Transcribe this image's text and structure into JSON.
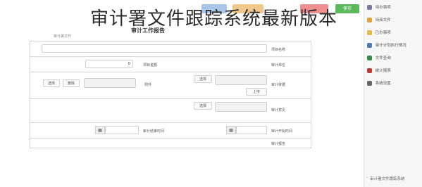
{
  "overlay": {
    "title": "审计署文件跟踪系统最新版本"
  },
  "colors": {
    "blue": "#a9c6e8",
    "orange": "#f2c98d",
    "red": "#ef8f8f",
    "green": "#5cb85c"
  },
  "toolbar": {
    "green_label": "保存"
  },
  "form": {
    "title": "审计工作报告",
    "subtitle": "审计署文件",
    "rows": [
      {
        "label": "项目名称"
      },
      {
        "label": "审计单位",
        "label_right": "项目金额",
        "amount_value": "0"
      },
      {
        "label": "审计依据",
        "btn_select": "选择",
        "btn_upload": "上传",
        "label_right": "附件",
        "btn_select2": "选择",
        "btn_delete": "删除"
      },
      {
        "label": "审计意见",
        "btn_select": "选择"
      },
      {
        "label": "审计开始时间",
        "label_right": "审计结束时间"
      },
      {
        "label": "审计报告"
      }
    ]
  },
  "sidebar": {
    "items": [
      {
        "label": "待办事项",
        "icon": "check-icon",
        "color": "#7a7aa0"
      },
      {
        "label": "待阅文件",
        "icon": "bell-icon",
        "color": "#e0a23b"
      },
      {
        "label": "已办事项",
        "icon": "folder-icon",
        "color": "#e6b84a"
      },
      {
        "label": "审计计划执行情况",
        "icon": "calendar-icon",
        "color": "#4a7ab5"
      },
      {
        "label": "文件查询",
        "icon": "search-icon",
        "color": "#3a8a4a"
      },
      {
        "label": "统计报表",
        "icon": "chart-icon",
        "color": "#c03a3a"
      },
      {
        "label": "系统设置",
        "icon": "gear-icon",
        "color": "#666666"
      }
    ],
    "footer": "审计署文件跟踪系统"
  }
}
